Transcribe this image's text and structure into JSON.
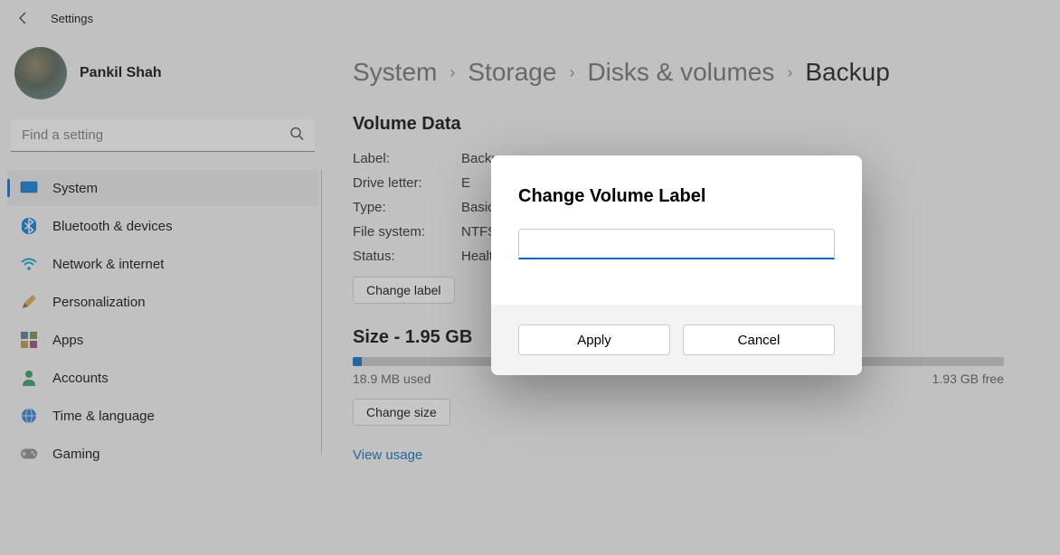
{
  "header": {
    "app_title": "Settings"
  },
  "profile": {
    "name": "Pankil Shah"
  },
  "search": {
    "placeholder": "Find a setting"
  },
  "sidebar": {
    "items": [
      {
        "label": "System",
        "icon": "system",
        "active": true
      },
      {
        "label": "Bluetooth & devices",
        "icon": "bluetooth",
        "active": false
      },
      {
        "label": "Network & internet",
        "icon": "wifi",
        "active": false
      },
      {
        "label": "Personalization",
        "icon": "brush",
        "active": false
      },
      {
        "label": "Apps",
        "icon": "apps",
        "active": false
      },
      {
        "label": "Accounts",
        "icon": "person",
        "active": false
      },
      {
        "label": "Time & language",
        "icon": "globe",
        "active": false
      },
      {
        "label": "Gaming",
        "icon": "game",
        "active": false
      }
    ]
  },
  "breadcrumb": {
    "items": [
      "System",
      "Storage",
      "Disks & volumes",
      "Backup"
    ],
    "sep": "›"
  },
  "volume": {
    "section_title": "Volume Data",
    "rows": [
      {
        "key": "Label:",
        "value": "Backup"
      },
      {
        "key": "Drive letter:",
        "value": "E"
      },
      {
        "key": "Type:",
        "value": "Basic"
      },
      {
        "key": "File system:",
        "value": "NTFS"
      },
      {
        "key": "Status:",
        "value": "Healthy"
      }
    ],
    "change_label_btn": "Change label"
  },
  "size": {
    "title": "Size - 1.95 GB",
    "used_label": "18.9 MB used",
    "free_label": "1.93 GB free",
    "change_size_btn": "Change size",
    "view_usage_link": "View usage"
  },
  "dialog": {
    "title": "Change Volume Label",
    "input_value": "",
    "apply": "Apply",
    "cancel": "Cancel"
  }
}
